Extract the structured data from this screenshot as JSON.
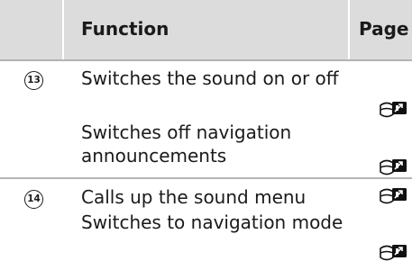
{
  "header": {
    "function_label": "Function",
    "page_label": "Page"
  },
  "rows": [
    {
      "number": "13",
      "functions": [
        "Switches the sound on or off",
        "Switches off navigation announcements"
      ],
      "page_icon": "steering-wheel-buttons-icon"
    },
    {
      "number": "14",
      "functions": [
        "Calls up the sound menu",
        "Switches to navigation mode"
      ],
      "page_icon": "steering-wheel-buttons-icon"
    }
  ]
}
